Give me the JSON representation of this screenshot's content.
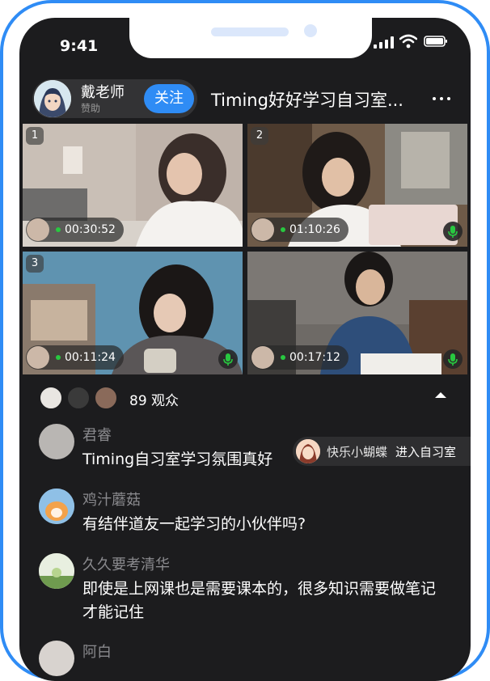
{
  "status_bar": {
    "time": "9:41"
  },
  "header": {
    "host_name": "戴老师",
    "host_subtitle": "赞助",
    "follow_label": "关注",
    "room_title": "Timing好好学习自习室..."
  },
  "tiles": [
    {
      "number": "1",
      "timer": "00:30:52"
    },
    {
      "number": "2",
      "timer": "01:10:26"
    },
    {
      "number": "3",
      "timer": "00:11:24"
    },
    {
      "number": "",
      "timer": "00:17:12"
    }
  ],
  "viewers": {
    "count_label": "89 观众"
  },
  "messages": [
    {
      "name": "君睿",
      "text": "Timing自习室学习氛围真好"
    },
    {
      "name": "鸡汁蘑菇",
      "text": "有结伴道友一起学习的小伙伴吗?"
    },
    {
      "name": "久久要考清华",
      "text": "即使是上网课也是需要课本的，很多知识需要做笔记才能记住"
    },
    {
      "name": "阿白",
      "text": ""
    }
  ],
  "toast": {
    "name": "快乐小蝴蝶",
    "action": "进入自习室"
  },
  "colors": {
    "accent": "#2f8cf5",
    "background": "#1c1c1e",
    "live": "#28c840"
  }
}
